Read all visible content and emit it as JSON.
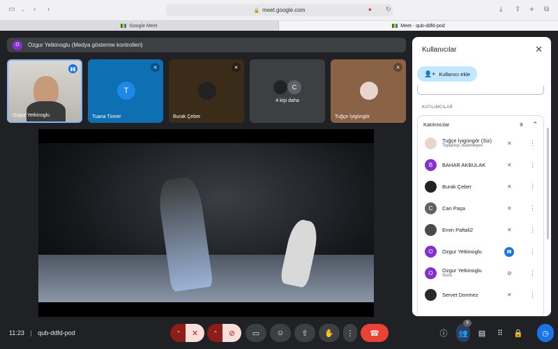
{
  "browser": {
    "url": "meet.google.com",
    "tabs": [
      {
        "label": "Google Meet"
      },
      {
        "label": "Meet - qub-ddfd-pod"
      }
    ]
  },
  "banner": {
    "avatar_letter": "O",
    "text": "Ozgur Yetkinoglu (Medya gösterme kontrolleri)"
  },
  "tiles": [
    {
      "name": "Ozgur Yetkinoglu"
    },
    {
      "name": "Tuana Tümer",
      "letter": "T"
    },
    {
      "name": "Burak Çeber"
    },
    {
      "name": "4 kişi daha",
      "letter": "C"
    },
    {
      "name": "Tuğçe İyigüngör"
    }
  ],
  "controls": {
    "time": "11:23",
    "separator": "|",
    "meeting_code": "qub-ddfd-pod",
    "people_count": "9"
  },
  "panel": {
    "title": "Kullanıcılar",
    "add_label": "Kullanıcı ekle",
    "section_label": "KATILIMCILAR",
    "list_header": "Katılımcılar",
    "count": "9",
    "participants": [
      {
        "name": "Tuğçe İyigüngör (Siz)",
        "sub": "Toplantıyı düzenleyen"
      },
      {
        "name": "BAHAR AKBULAK",
        "letter": "B"
      },
      {
        "name": "Burak Çeber"
      },
      {
        "name": "Can Paşa",
        "letter": "C"
      },
      {
        "name": "Emin Paftali2"
      },
      {
        "name": "Ozgur Yetkinoglu",
        "letter": "O"
      },
      {
        "name": "Ozgur Yetkinoglu",
        "letter": "O",
        "sub": "Sunu"
      },
      {
        "name": "Servet Donmez"
      }
    ]
  },
  "colors": {
    "accent_blue": "#1a73e8",
    "avatar_purple": "#8430ce",
    "avatar_blue": "#1e88e5",
    "avatar_gray": "#5f6368",
    "danger_red": "#ea4335",
    "panel_bg": "#ffffff",
    "stage_bg": "#202124"
  }
}
